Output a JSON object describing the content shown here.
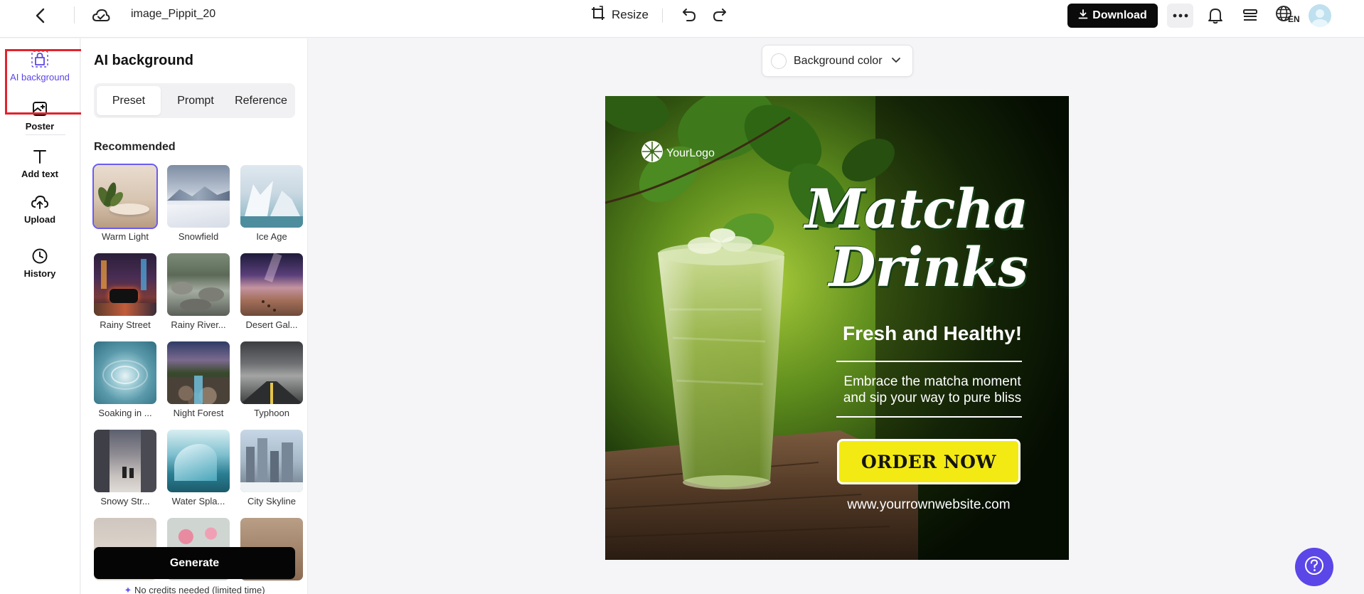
{
  "header": {
    "file_name": "image_Pippit_20",
    "resize_label": "Resize",
    "download_label": "Download",
    "language_code": "EN",
    "icons": [
      "back-icon",
      "cloud-sync-icon",
      "resize-icon",
      "undo-icon",
      "redo-icon",
      "download-icon",
      "more-icon",
      "bell-icon",
      "layers-icon",
      "globe-icon"
    ]
  },
  "rail": {
    "items": [
      {
        "label": "AI background",
        "icon": "ai-background-icon",
        "active": true
      },
      {
        "label": "Poster",
        "icon": "poster-icon"
      },
      {
        "label": "Add text",
        "icon": "text-icon"
      },
      {
        "label": "Upload",
        "icon": "upload-icon"
      },
      {
        "label": "History",
        "icon": "history-icon"
      }
    ]
  },
  "panel": {
    "title": "AI background",
    "tabs": [
      {
        "label": "Preset",
        "active": true
      },
      {
        "label": "Prompt"
      },
      {
        "label": "Reference"
      }
    ],
    "section_label": "Recommended",
    "presets": [
      {
        "label": "Warm Light",
        "selected": true
      },
      {
        "label": "Snowfield"
      },
      {
        "label": "Ice Age"
      },
      {
        "label": "Rainy Street"
      },
      {
        "label": "Rainy River..."
      },
      {
        "label": "Desert Gal..."
      },
      {
        "label": "Soaking in ..."
      },
      {
        "label": "Night Forest"
      },
      {
        "label": "Typhoon"
      },
      {
        "label": "Snowy Str..."
      },
      {
        "label": "Water Spla..."
      },
      {
        "label": "City Skyline"
      }
    ],
    "generate_label": "Generate",
    "credits_note": "No credits needed (limited time)"
  },
  "canvas": {
    "background_color_label": "Background color",
    "poster": {
      "logo_text": "YourLogo",
      "title_line1": "Matcha",
      "title_line2": "Drinks",
      "subtitle": "Fresh and Healthy!",
      "body_line1": "Embrace the matcha moment",
      "body_line2": "and sip your way to pure bliss",
      "cta": "ORDER NOW",
      "website": "www.yourrownwebsite.com"
    }
  },
  "colors": {
    "accent": "#5b46e8",
    "download_bg": "#0b0b0b",
    "cta_yellow": "#f3ea14",
    "highlight_red": "#e0242e"
  }
}
